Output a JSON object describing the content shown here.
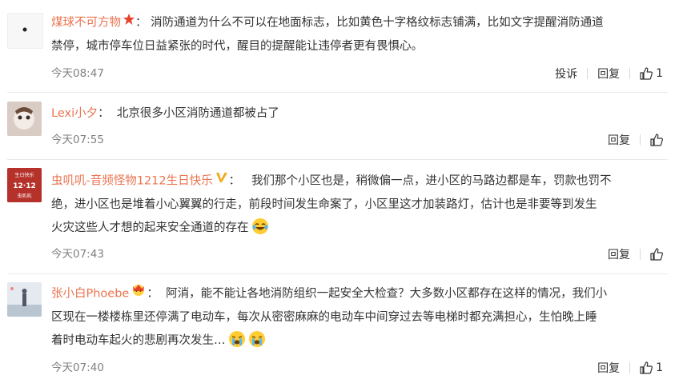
{
  "comments": [
    {
      "user": "煤球不可方物",
      "colon": "：",
      "text_lines": [
        "消防通道为什么不可以在地面标志，比如黄色十字格纹标志铺满，比如文字提醒消防通道",
        "禁停，城市停车位日益紧张的时代，醒目的提醒能让违停者更有畏惧心。"
      ],
      "time": "今天08:47",
      "report_label": "投诉",
      "reply_label": "回复",
      "likes": "1"
    },
    {
      "user": "Lexi小夕",
      "colon": "：",
      "text_lines": [
        "北京很多小区消防通道都被占了"
      ],
      "time": "今天07:55",
      "reply_label": "回复",
      "likes": ""
    },
    {
      "user": "虫叽叽-音频怪物1212生日快乐",
      "colon": "：",
      "text_lines": [
        "我们那个小区也是，稍微偏一点，进小区的马路边都是车，罚款也罚不",
        "绝，进小区也是堆着小心翼翼的行走，前段时间发生命案了，小区里这才加装路灯，估计也是非要等到发生",
        "火灾这些人才想的起来安全通道的存在"
      ],
      "time": "今天07:43",
      "reply_label": "回复",
      "likes": "",
      "avatar_text": [
        "生日快乐",
        "12·12",
        "虫叽叽"
      ]
    },
    {
      "user": "张小白Phoebe",
      "colon": "：",
      "text_lines": [
        "阿消，能不能让各地消防组织一起安全大检查？大多数小区都存在这样的情况，我们小",
        "区现在一楼楼栋里还停满了电动车，每次从密密麻麻的电动车中间穿过去等电梯时都充满担心，生怕晚上睡",
        "着时电动车起火的悲剧再次发生…"
      ],
      "time": "今天07:40",
      "reply_label": "回复",
      "likes": "1"
    }
  ],
  "colors": {
    "username": "#eb7350",
    "text": "#333333",
    "meta": "#808080"
  }
}
